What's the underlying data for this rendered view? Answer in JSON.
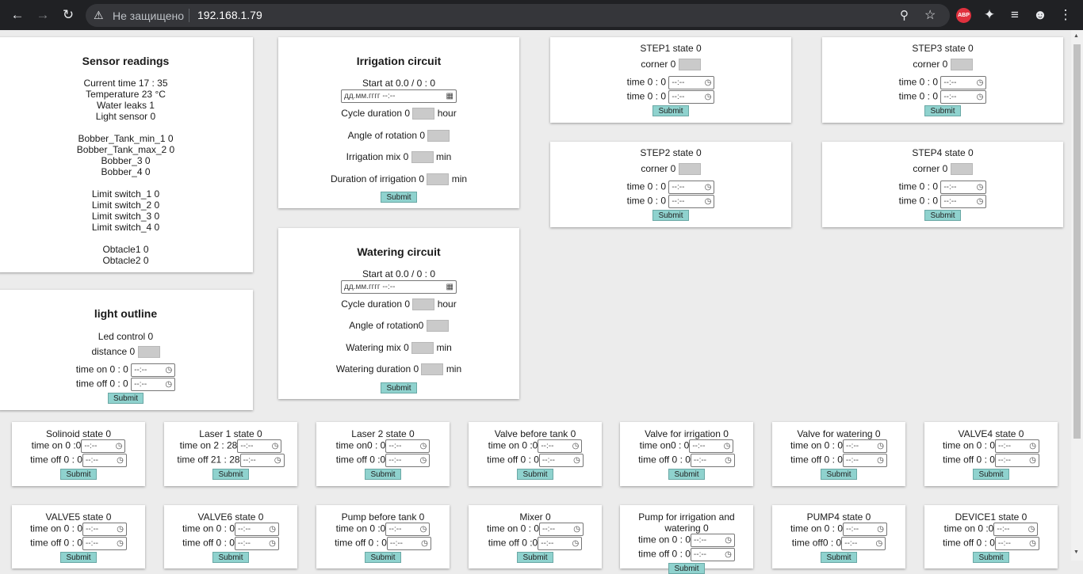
{
  "browser": {
    "security_label": "Не защищено",
    "url": "192.168.1.79",
    "ext_label": "ABP"
  },
  "time_placeholder": "--:--",
  "sensor": {
    "title": "Sensor readings",
    "lines": [
      "Current time 17 : 35",
      "Temperature 23 °C",
      "Water leaks 1",
      "Light sensor 0",
      "",
      "Bobber_Tank_min_1 0",
      "Bobber_Tank_max_2 0",
      "Bobber_3 0",
      "Bobber_4 0",
      "",
      "Limit switch_1 0",
      "Limit switch_2 0",
      "Limit switch_3 0",
      "Limit switch_4 0",
      "",
      "Obtacle1 0",
      "Obtacle2 0"
    ]
  },
  "light": {
    "title": "light outline",
    "led": "Led control 0",
    "distance": "distance 0",
    "time_on": "time on 0 : 0",
    "time_off": "time off 0 : 0",
    "submit": "Submit"
  },
  "irrigation": {
    "title": "Irrigation circuit",
    "start": "Start at 0.0  /  0 : 0",
    "datetime_placeholder": "дд.мм.гггг --:--",
    "cycle": "Cycle duration 0",
    "cycle_unit": "hour",
    "angle": "Angle of rotation 0",
    "mix": "Irrigation mix 0",
    "mix_unit": "min",
    "duration": "Duration of irrigation 0",
    "duration_unit": "min",
    "submit": "Submit"
  },
  "watering": {
    "title": "Watering circuit",
    "start": "Start at 0.0  /  0 : 0",
    "datetime_placeholder": "дд.мм.гггг --:--",
    "cycle": "Cycle duration 0",
    "cycle_unit": "hour",
    "angle": "Angle of rotation0",
    "mix": "Watering mix 0",
    "mix_unit": "min",
    "duration": "Watering duration 0",
    "duration_unit": "min",
    "submit": "Submit"
  },
  "steps": [
    {
      "title": "STEP1 state 0",
      "corner": "corner 0",
      "t1": "time 0 : 0",
      "t2": "time 0 : 0",
      "submit": "Submit"
    },
    {
      "title": "STEP3 state 0",
      "corner": "corner 0",
      "t1": "time 0 : 0",
      "t2": "time 0 : 0",
      "submit": "Submit"
    },
    {
      "title": "STEP2 state 0",
      "corner": "corner 0",
      "t1": "time 0 : 0",
      "t2": "time 0 : 0",
      "submit": "Submit"
    },
    {
      "title": "STEP4 state 0",
      "corner": "corner 0",
      "t1": "time 0 : 0",
      "t2": "time 0 : 0",
      "submit": "Submit"
    }
  ],
  "devices": [
    {
      "title": "Solinoid state 0",
      "on": "time on 0 :0",
      "off": "time off 0 : 0",
      "submit": "Submit"
    },
    {
      "title": "Laser 1 state 0",
      "on": "time on 2 : 28",
      "off": "time off 21 : 28",
      "submit": "Submit"
    },
    {
      "title": "Laser 2 state 0",
      "on": "time on0 : 0",
      "off": "time off 0 :0",
      "submit": "Submit"
    },
    {
      "title": "Valve before tank 0",
      "on": "time on 0 :0",
      "off": "time off 0 : 0",
      "submit": "Submit"
    },
    {
      "title": "Valve for irrigation 0",
      "on": "time on0 : 0",
      "off": "time off 0 : 0",
      "submit": "Submit"
    },
    {
      "title": "Valve for watering 0",
      "on": "time on 0 : 0",
      "off": "time off 0 : 0",
      "submit": "Submit"
    },
    {
      "title": "VALVE4 state 0",
      "on": "time on 0 : 0",
      "off": "time off 0 : 0",
      "submit": "Submit"
    },
    {
      "title": "VALVE5 state 0",
      "on": "time on 0 : 0",
      "off": "time off 0 : 0",
      "submit": "Submit"
    },
    {
      "title": "VALVE6 state 0",
      "on": "time on 0 : 0",
      "off": "time off 0 : 0",
      "submit": "Submit"
    },
    {
      "title": "Pump before tank 0",
      "on": "time on 0 :0",
      "off": "time off 0 : 0",
      "submit": "Submit"
    },
    {
      "title": "Mixer 0",
      "on": "time on 0 : 0",
      "off": "time off 0 :0",
      "submit": "Submit"
    },
    {
      "title": "Pump for irrigation and watering 0",
      "on": "time on 0 : 0",
      "off": "time off 0 : 0",
      "submit": "Submit"
    },
    {
      "title": "PUMP4 state 0",
      "on": "time on 0 : 0",
      "off": "time off0 : 0",
      "submit": "Submit"
    },
    {
      "title": "DEVICE1 state 0",
      "on": "time on 0 :0",
      "off": "time off 0 : 0",
      "submit": "Submit"
    }
  ]
}
